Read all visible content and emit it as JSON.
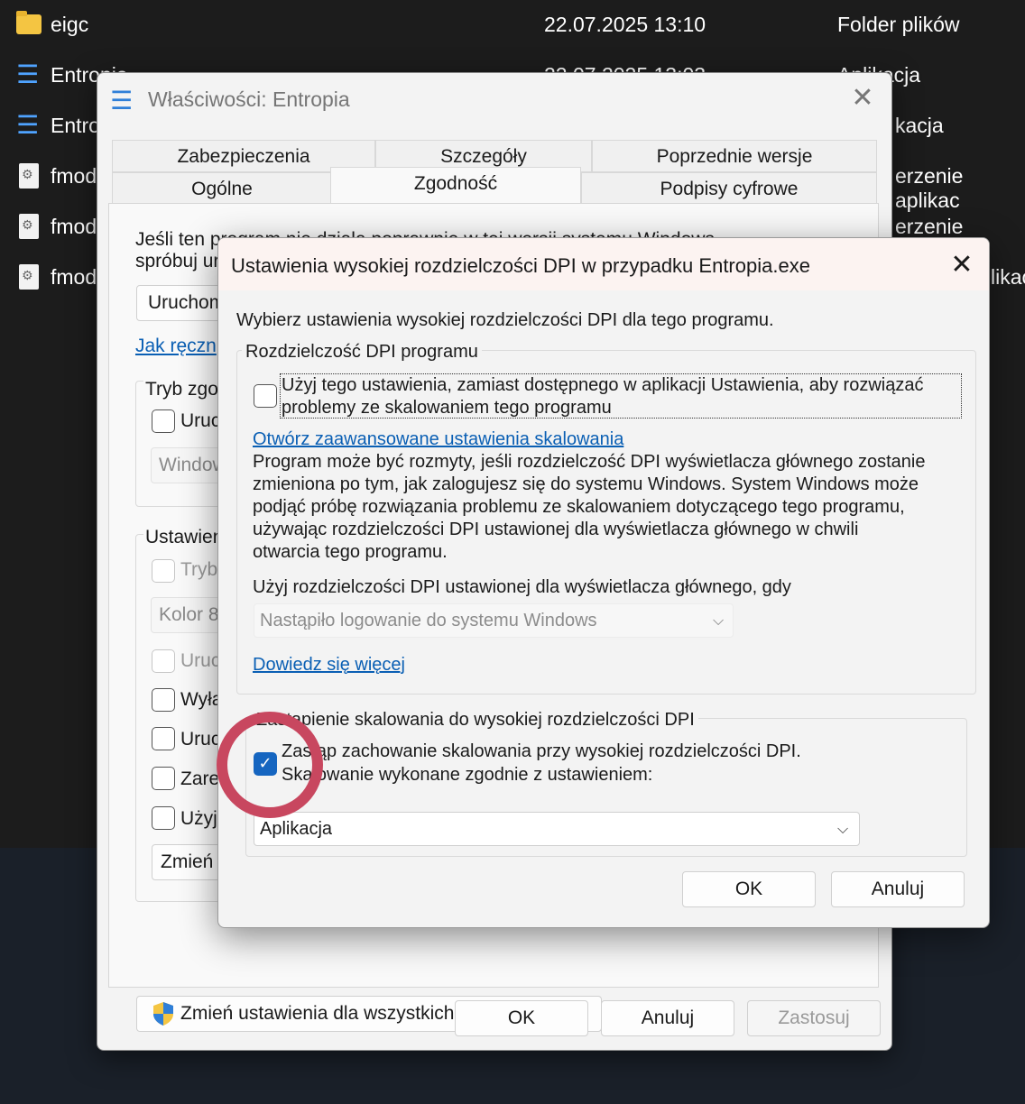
{
  "explorer": {
    "files": [
      {
        "name": "eigc",
        "date": "22.07.2025 13:10",
        "type": "Folder plików",
        "icon": "folder-icon"
      },
      {
        "name": "Entropia",
        "date": "22.07.2025 13:03",
        "type": "Aplikacja",
        "icon": "exe-icon"
      },
      {
        "name": "Entro",
        "date": "",
        "type": "kacja",
        "icon": "exe-icon"
      },
      {
        "name": "fmod",
        "date": "",
        "type": "erzenie aplikac",
        "icon": "dll-icon"
      },
      {
        "name": "fmod",
        "date": "",
        "type": "erzenie aplikac",
        "icon": "dll-icon"
      },
      {
        "name": "fmod",
        "date": "",
        "type": "likac",
        "icon": "dll-icon"
      }
    ]
  },
  "properties": {
    "title": "Właściwości: Entropia",
    "close": "✕",
    "tabs_top": [
      "Zabezpieczenia",
      "Szczegóły",
      "Poprzednie wersje"
    ],
    "tabs_bottom": [
      "Ogólne",
      "Zgodność",
      "Podpisy cyfrowe"
    ],
    "intro_line1": "Jeśli ten program nie działa poprawnie w tej wersji systemu Windows,",
    "intro_line2": "spróbuj ur",
    "run_troubleshooter": "Uruchom",
    "manual_link": "Jak ręczn",
    "compat_group": "Tryb zgo",
    "compat_checkbox": "Uruc",
    "compat_combo": "Window",
    "settings_group": "Ustawien",
    "reduced_color": "Tryb",
    "color_combo": "Kolor 8",
    "run_640": "Uruc",
    "disable_fullscreen": "Wyła",
    "run_admin": "Uruc",
    "register_restart": "Zare",
    "use_legacy": "Użyj",
    "change_dpi_btn": "Zmień",
    "all_users_btn": "Zmień ustawienia dla wszystkich użytkowników",
    "ok": "OK",
    "cancel": "Anuluj",
    "apply": "Zastosuj"
  },
  "dpi_dialog": {
    "title": "Ustawienia wysokiej rozdzielczości DPI w przypadku Entropia.exe",
    "close": "✕",
    "intro": "Wybierz ustawienia wysokiej rozdzielczości DPI dla tego programu.",
    "program_dpi_group": "Rozdzielczość DPI programu",
    "use_setting_line1": "Użyj tego ustawienia, zamiast dostępnego w aplikacji Ustawienia, aby rozwiązać",
    "use_setting_line2": "problemy ze skalowaniem tego programu",
    "advanced_link": "Otwórz zaawansowane ustawienia skalowania",
    "desc_lines": [
      "Program może być rozmyty, jeśli rozdzielczość DPI wyświetlacza głównego zostanie",
      "zmieniona po tym, jak zalogujesz się do systemu Windows. System Windows może",
      "podjąć próbę rozwiązania problemu ze skalowaniem dotyczącego tego programu,",
      "używając rozdzielczości DPI ustawionej dla wyświetlacza głównego w chwili",
      "otwarcia tego programu."
    ],
    "use_dpi_when": "Użyj rozdzielczości DPI ustawionej dla wyświetlacza głównego, gdy",
    "when_combo": "Nastąpiło logowanie do systemu Windows",
    "learn_more": "Dowiedz się więcej",
    "override_group": "Zastąpienie skalowania do wysokiej rozdzielczości DPI",
    "override_line1": "Zastąp zachowanie skalowania przy wysokiej rozdzielczości DPI.",
    "override_line2": "Skalowanie wykonane zgodnie z ustawieniem:",
    "override_checked": true,
    "scaling_combo": "Aplikacja",
    "ok": "OK",
    "cancel": "Anuluj"
  },
  "colors": {
    "accent": "#1565c0",
    "link": "#0a5fb4",
    "highlight_ring": "#c8475f"
  }
}
